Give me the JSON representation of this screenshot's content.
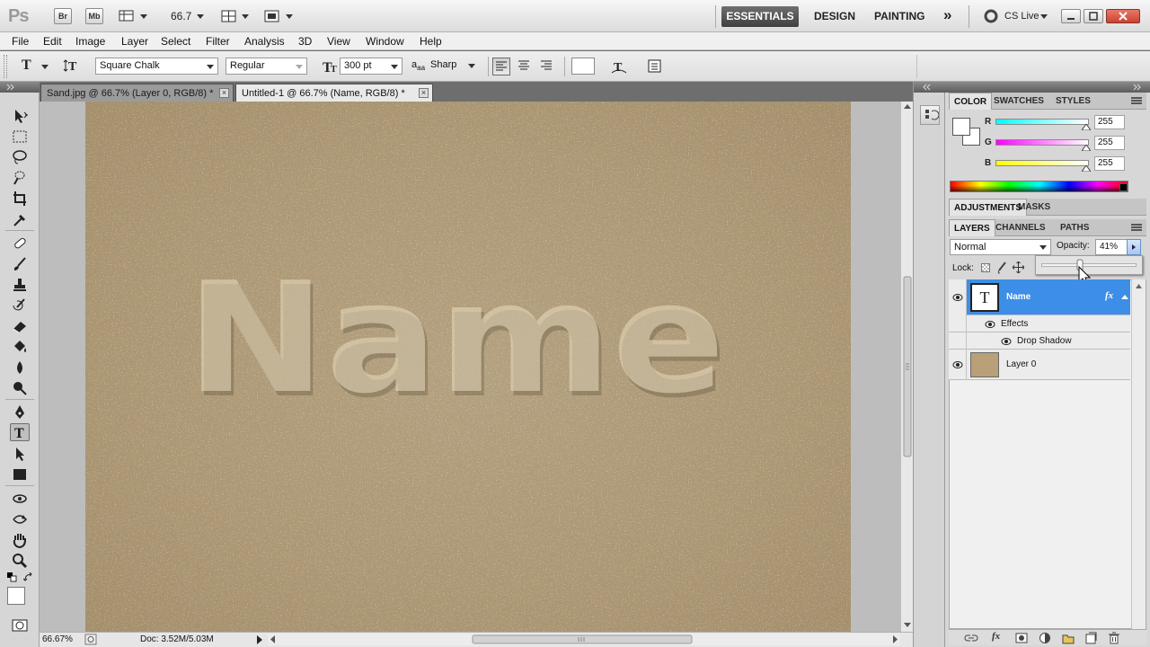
{
  "appbar": {
    "logo": "Ps",
    "bridge_label": "Br",
    "minibridge_label": "Mb",
    "zoom_value": "66.7",
    "workspaces": [
      "ESSENTIALS",
      "DESIGN",
      "PAINTING"
    ],
    "more_workspaces": "»",
    "cslive": "CS Live"
  },
  "menubar": [
    "File",
    "Edit",
    "Image",
    "Layer",
    "Select",
    "Filter",
    "Analysis",
    "3D",
    "View",
    "Window",
    "Help"
  ],
  "options": {
    "tool_glyph": "T",
    "font_family": "Square Chalk",
    "font_style": "Regular",
    "font_size": "300 pt",
    "aa_prefix": "a",
    "aa_label": "aa",
    "antialias": "Sharp",
    "text_color": "#ffffff"
  },
  "tabs": [
    {
      "label": "Sand.jpg @ 66.7% (Layer 0, RGB/8) *",
      "active": false
    },
    {
      "label": "Untitled-1 @ 66.7% (Name, RGB/8) *",
      "active": true
    }
  ],
  "tab_close": "×",
  "canvas": {
    "text": "Name",
    "sand_color": "#b9a078"
  },
  "statusbar": {
    "zoom": "66.67%",
    "doc": "Doc: 3.52M/5.03M"
  },
  "color_panel": {
    "tabs": [
      "COLOR",
      "SWATCHES",
      "STYLES"
    ],
    "channels": [
      {
        "label": "R",
        "value": "255"
      },
      {
        "label": "G",
        "value": "255"
      },
      {
        "label": "B",
        "value": "255"
      }
    ]
  },
  "adjustments_panel": {
    "tabs": [
      "ADJUSTMENTS",
      "MASKS"
    ]
  },
  "layers_panel": {
    "tabs": [
      "LAYERS",
      "CHANNELS",
      "PATHS"
    ],
    "blend_mode": "Normal",
    "opacity_label": "Opacity:",
    "opacity_value": "41%",
    "opacity_fraction": 0.41,
    "lock_label": "Lock:",
    "layers": [
      {
        "name": "Name",
        "type": "text",
        "selected": true,
        "thumb_glyph": "T",
        "fx": "fx"
      },
      {
        "name": "Effects",
        "type": "effects-group"
      },
      {
        "name": "Drop Shadow",
        "type": "effect"
      },
      {
        "name": "Layer 0",
        "type": "image",
        "selected": false
      }
    ]
  }
}
